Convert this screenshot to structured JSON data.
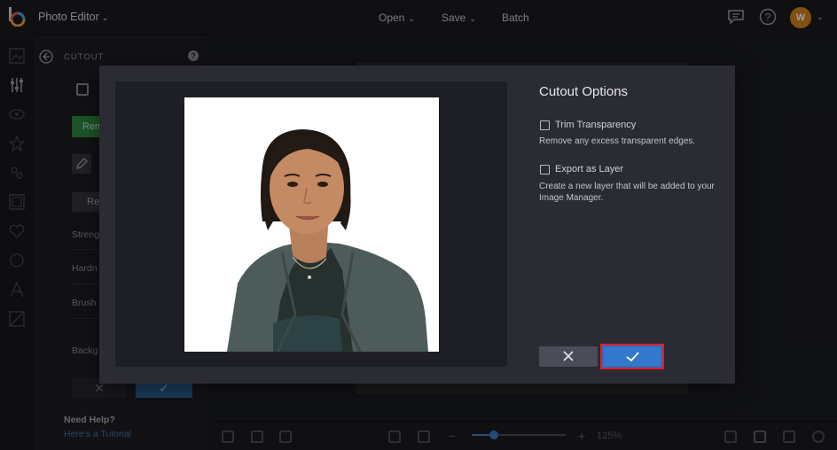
{
  "topbar": {
    "app_title": "Photo Editor",
    "menu": [
      {
        "label": "Open"
      },
      {
        "label": "Save"
      },
      {
        "label": "Batch"
      }
    ],
    "avatar_initial": "W"
  },
  "panel": {
    "title": "CUTOUT",
    "remove_label": "Rem",
    "re_label": "Re",
    "strength_label": "Streng",
    "hardness_label": "Hardn",
    "brush_label": "Brush",
    "background_label": "Backg",
    "need_help": "Need Help?",
    "tutorial_link": "Here's a Tutorial"
  },
  "bottombar": {
    "zoom_value": "125%",
    "zoom_level": 0.18
  },
  "modal": {
    "title": "Cutout Options",
    "options": [
      {
        "label": "Trim Transparency",
        "checked": false,
        "description": "Remove any excess transparent edges."
      },
      {
        "label": "Export as Layer",
        "checked": false,
        "description": "Create a new layer that will be added to your Image Manager."
      }
    ],
    "cancel_icon": "close-icon",
    "apply_icon": "check-icon"
  },
  "colors": {
    "accent": "#3378cc",
    "highlight_border": "#e01d2a",
    "avatar": "#d2821c",
    "remove_button": "#2f8a3f"
  }
}
